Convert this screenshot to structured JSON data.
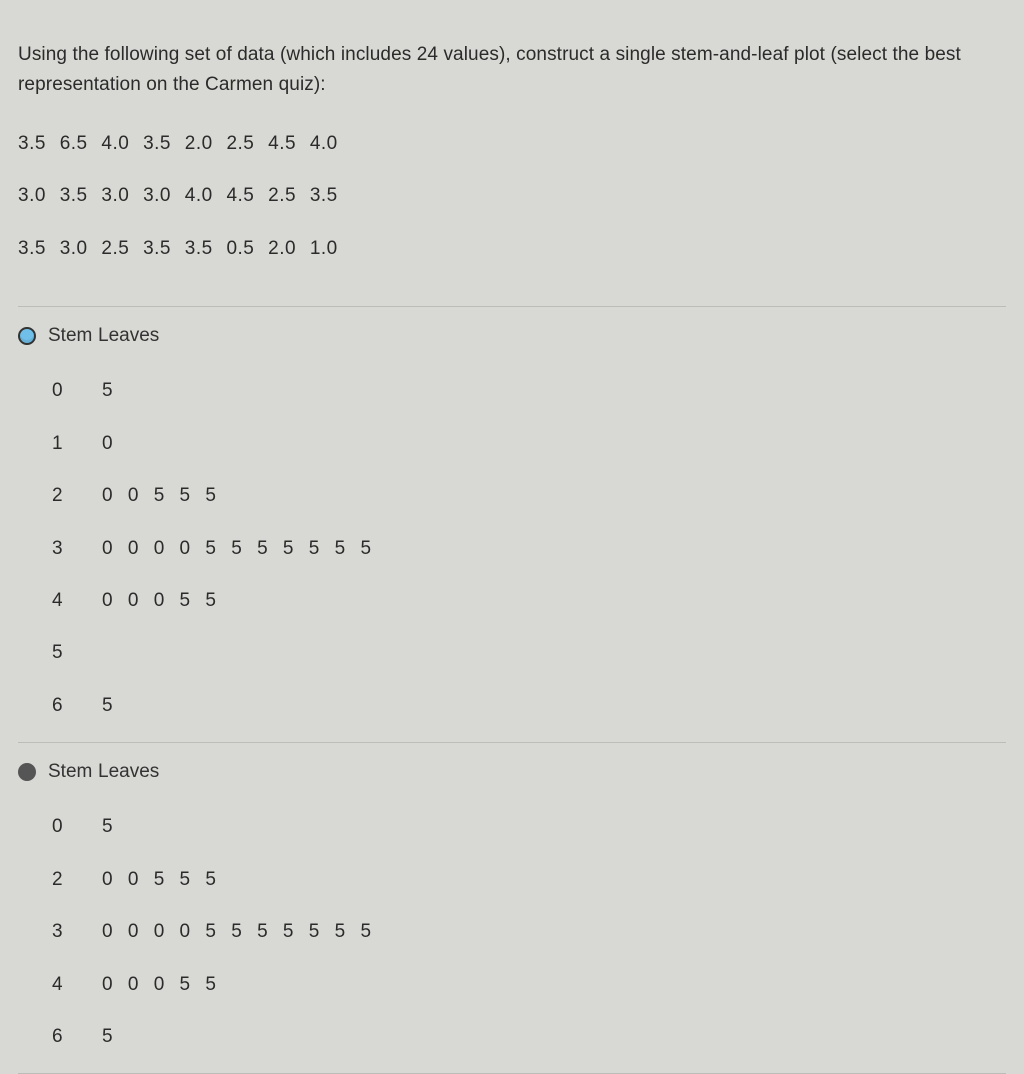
{
  "question": "Using the following set of data (which includes 24 values), construct a single stem-and-leaf plot (select the best representation on the Carmen quiz):",
  "data_rows": [
    "3.5 6.5 4.0 3.5 2.0 2.5 4.5 4.0",
    "3.0 3.5 3.0 3.0 4.0 4.5 2.5 3.5",
    "3.5 3.0 2.5 3.5 3.5 0.5 2.0 1.0"
  ],
  "stem_label": "Stem",
  "leaves_label": "Leaves",
  "options": [
    {
      "radio_style": "highlight",
      "rows": [
        {
          "stem": "0",
          "leaves": "5"
        },
        {
          "stem": "1",
          "leaves": "0"
        },
        {
          "stem": "2",
          "leaves": "0 0 5 5 5"
        },
        {
          "stem": "3",
          "leaves": "0 0 0 0 5 5 5 5 5 5 5"
        },
        {
          "stem": "4",
          "leaves": "0 0 0 5 5"
        },
        {
          "stem": "5",
          "leaves": ""
        },
        {
          "stem": "6",
          "leaves": "5"
        }
      ]
    },
    {
      "radio_style": "dark",
      "rows": [
        {
          "stem": "0",
          "leaves": "5"
        },
        {
          "stem": "2",
          "leaves": "0 0 5 5 5"
        },
        {
          "stem": "3",
          "leaves": "0 0 0 0 5 5 5 5 5 5 5"
        },
        {
          "stem": "4",
          "leaves": "0 0 0 5 5"
        },
        {
          "stem": "6",
          "leaves": "5"
        }
      ]
    }
  ]
}
